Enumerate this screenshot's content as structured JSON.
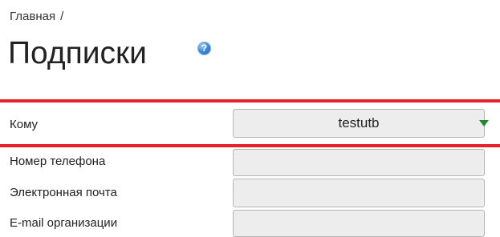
{
  "breadcrumb": {
    "home": "Главная",
    "separator": "/"
  },
  "page": {
    "title": "Подписки",
    "help_icon": "question-circle-icon",
    "help_symbol": "?"
  },
  "form": {
    "to": {
      "label": "Кому",
      "value": "testutb",
      "dropdown_icon": "triangle-down-icon"
    },
    "phone": {
      "label": "Номер телефона",
      "value": ""
    },
    "email": {
      "label": "Электронная почта",
      "value": ""
    },
    "org_email": {
      "label": "E-mail организации",
      "value": ""
    }
  },
  "colors": {
    "highlight": "#e8202a",
    "arrow": "#1f8a2b",
    "field_bg": "#ededed",
    "help_icon": "#3c8bd6"
  }
}
